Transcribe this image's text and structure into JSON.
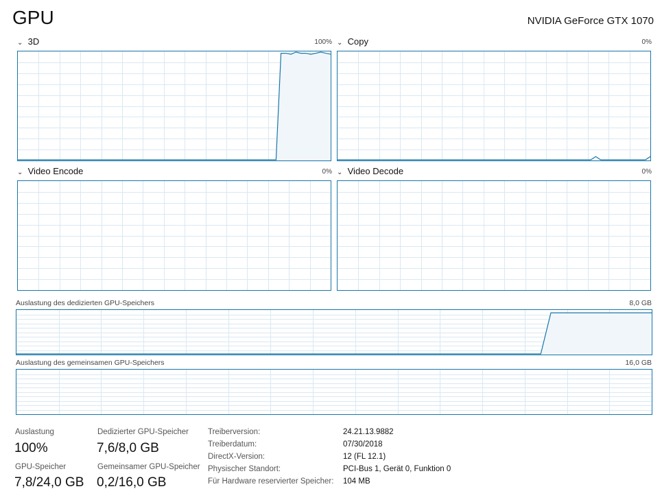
{
  "header": {
    "title": "GPU",
    "device": "NVIDIA GeForce GTX 1070"
  },
  "engines": [
    {
      "label": "3D",
      "percent": "100%",
      "history": [
        0,
        0,
        0,
        0,
        0,
        0,
        0,
        0,
        0,
        0,
        0,
        0,
        0,
        0,
        0,
        0,
        0,
        0,
        0,
        0,
        0,
        0,
        0,
        0,
        0,
        0,
        0,
        0,
        0,
        0,
        0,
        0,
        0,
        0,
        0,
        0,
        0,
        0,
        0,
        0,
        0,
        0,
        0,
        0,
        0,
        0,
        0,
        0,
        0,
        0,
        0,
        0,
        0,
        99,
        99,
        98,
        100,
        99,
        99,
        98,
        99,
        100,
        99,
        98
      ]
    },
    {
      "label": "Copy",
      "percent": "0%",
      "history": [
        0,
        0,
        0,
        0,
        0,
        0,
        0,
        0,
        0,
        0,
        0,
        0,
        0,
        0,
        0,
        0,
        0,
        0,
        0,
        0,
        0,
        0,
        0,
        0,
        0,
        0,
        0,
        0,
        0,
        0,
        0,
        0,
        0,
        0,
        0,
        0,
        0,
        0,
        0,
        0,
        0,
        0,
        0,
        0,
        0,
        0,
        0,
        0,
        0,
        0,
        0,
        0,
        3,
        0,
        0,
        0,
        0,
        0,
        0,
        0,
        0,
        0,
        0,
        3
      ]
    },
    {
      "label": "Video Encode",
      "percent": "0%",
      "history": []
    },
    {
      "label": "Video Decode",
      "percent": "0%",
      "history": []
    }
  ],
  "memory": {
    "dedicated": {
      "label": "Auslastung des dedizierten GPU-Speichers",
      "max": "8,0 GB",
      "history": [
        0,
        0,
        0,
        0,
        0,
        0,
        0,
        0,
        0,
        0,
        0,
        0,
        0,
        0,
        0,
        0,
        0,
        0,
        0,
        0,
        0,
        0,
        0,
        0,
        0,
        0,
        0,
        0,
        0,
        0,
        0,
        0,
        0,
        0,
        0,
        0,
        0,
        0,
        0,
        0,
        0,
        0,
        0,
        0,
        0,
        0,
        0,
        0,
        0,
        0,
        0,
        0,
        0,
        95,
        95,
        95,
        95,
        95,
        95,
        95,
        95,
        95,
        95,
        95
      ]
    },
    "shared": {
      "label": "Auslastung des gemeinsamen GPU-Speichers",
      "max": "16,0 GB",
      "history": []
    }
  },
  "stats": {
    "utilization": {
      "label": "Auslastung",
      "value": "100%"
    },
    "dedicated": {
      "label": "Dedizierter GPU-Speicher",
      "value": "7,6/8,0 GB"
    },
    "gpu_memory": {
      "label": "GPU-Speicher",
      "value": "7,8/24,0 GB"
    },
    "shared": {
      "label": "Gemeinsamer GPU-Speicher",
      "value": "0,2/16,0 GB"
    }
  },
  "info": [
    {
      "label": "Treiberversion:",
      "value": "24.21.13.9882"
    },
    {
      "label": "Treiberdatum:",
      "value": "07/30/2018"
    },
    {
      "label": "DirectX-Version:",
      "value": "12 (FL 12.1)"
    },
    {
      "label": "Physischer Standort:",
      "value": "PCI-Bus 1, Gerät 0, Funktion 0"
    },
    {
      "label": "Für Hardware reservierter Speicher:",
      "value": "104 MB"
    }
  ],
  "colors": {
    "accent": "#1776a8",
    "fill": "#f1f6fb",
    "grid": "#d9e8f2"
  }
}
